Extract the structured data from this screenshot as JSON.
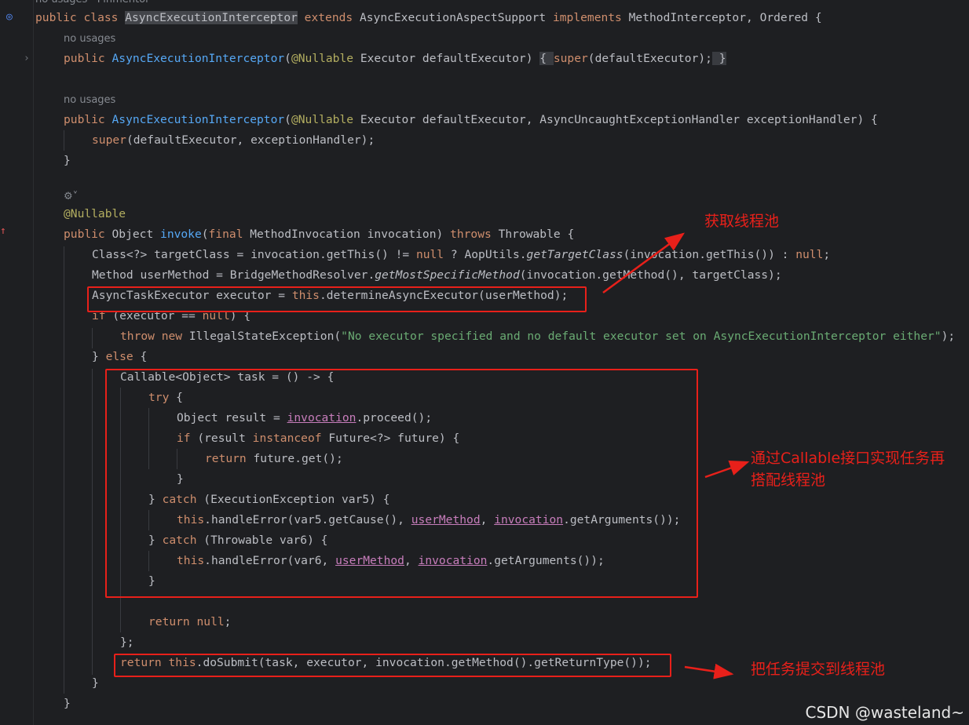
{
  "editor": {
    "top_hint": "no usages   Pinmentor",
    "hints": {
      "no_usages": "no usages"
    },
    "lines": {
      "l1": {
        "a": "public class ",
        "b": "AsyncExecutionInterceptor",
        "c": " extends ",
        "d": "AsyncExecutionAspectSupport ",
        "e": "implements ",
        "f": "MethodInterceptor, Ordered {"
      },
      "l2": {
        "a": "public ",
        "b": "AsyncExecutionInterceptor",
        "c": "(",
        "d": "@Nullable",
        "e": " Executor defaultExecutor) ",
        "f": "{ ",
        "g": "super",
        "h": "(defaultExecutor);",
        "i": " }"
      },
      "l3": {
        "a": "public ",
        "b": "AsyncExecutionInterceptor",
        "c": "(",
        "d": "@Nullable",
        "e": " Executor defaultExecutor, AsyncUncaughtExceptionHandler exceptionHandler) {"
      },
      "l4": {
        "a": "super",
        "b": "(defaultExecutor, exceptionHandler);"
      },
      "l5": {
        "a": "}"
      },
      "l6": {
        "a": "@Nullable"
      },
      "l7": {
        "a": "public ",
        "b": "Object ",
        "c": "invoke",
        "d": "(",
        "e": "final ",
        "f": "MethodInvocation invocation) ",
        "g": "throws ",
        "h": "Throwable {"
      },
      "l8": {
        "a": "Class<?> targetClass = invocation.getThis() != ",
        "b": "null",
        "c": " ? AopUtils.",
        "d": "getTargetClass",
        "e": "(invocation.getThis()) : ",
        "f": "null",
        "g": ";"
      },
      "l9": {
        "a": "Method userMethod = BridgeMethodResolver.",
        "b": "getMostSpecificMethod",
        "c": "(invocation.getMethod(), targetClass);"
      },
      "l10": {
        "a": "AsyncTaskExecutor executor = ",
        "b": "this",
        "c": ".determineAsyncExecutor(userMethod);"
      },
      "l11": {
        "a": "if",
        "b": " (executor == ",
        "c": "null",
        "d": ") {"
      },
      "l12": {
        "a": "throw new ",
        "b": "IllegalStateException(",
        "c": "\"No executor specified and no default executor set on AsyncExecutionInterceptor either\"",
        "d": ");"
      },
      "l13": {
        "a": "} ",
        "b": "else",
        "c": " {"
      },
      "l14": {
        "a": "Callable<Object> task = () -> {"
      },
      "l15": {
        "a": "try",
        "b": " {"
      },
      "l16": {
        "a": "Object result = ",
        "b": "invocation",
        "c": ".proceed();"
      },
      "l17": {
        "a": "if",
        "b": " (result ",
        "c": "instanceof",
        "d": " Future<?> future) {"
      },
      "l18": {
        "a": "return",
        "b": " future.get();"
      },
      "l19": {
        "a": "}"
      },
      "l20": {
        "a": "} ",
        "b": "catch",
        "c": " (ExecutionException var5) {"
      },
      "l21": {
        "a": "this",
        "b": ".handleError(var5.getCause(), ",
        "c": "userMethod",
        "d": ", ",
        "e": "invocation",
        "f": ".getArguments());"
      },
      "l22": {
        "a": "} ",
        "b": "catch",
        "c": " (Throwable var6) {"
      },
      "l23": {
        "a": "this",
        "b": ".handleError(var6, ",
        "c": "userMethod",
        "d": ", ",
        "e": "invocation",
        "f": ".getArguments());"
      },
      "l24": {
        "a": "}"
      },
      "l25": {
        "a": "return null",
        "b": ";"
      },
      "l26": {
        "a": "};"
      },
      "l27": {
        "a": "return this",
        "b": ".doSubmit(task, executor, invocation.getMethod().getReturnType());"
      },
      "l28": {
        "a": "}"
      },
      "l29": {
        "a": "}"
      }
    }
  },
  "annotations": {
    "get_pool": "获取线程池",
    "callable_line1": "通过Callable接口实现任务再",
    "callable_line2": "搭配线程池",
    "submit": "把任务提交到线程池"
  },
  "watermark": "CSDN @wasteland~",
  "colors": {
    "background": "#1e1f22",
    "keyword": "#cf8e6d",
    "method": "#56a8f5",
    "annotation": "#b3ae60",
    "string": "#6aab73",
    "field": "#c77dbb",
    "markup_red": "#e8201a"
  },
  "icons": [
    "implementation-icon",
    "fold-chevron-icon",
    "override-arrow-icon",
    "ai-hint-icon"
  ]
}
